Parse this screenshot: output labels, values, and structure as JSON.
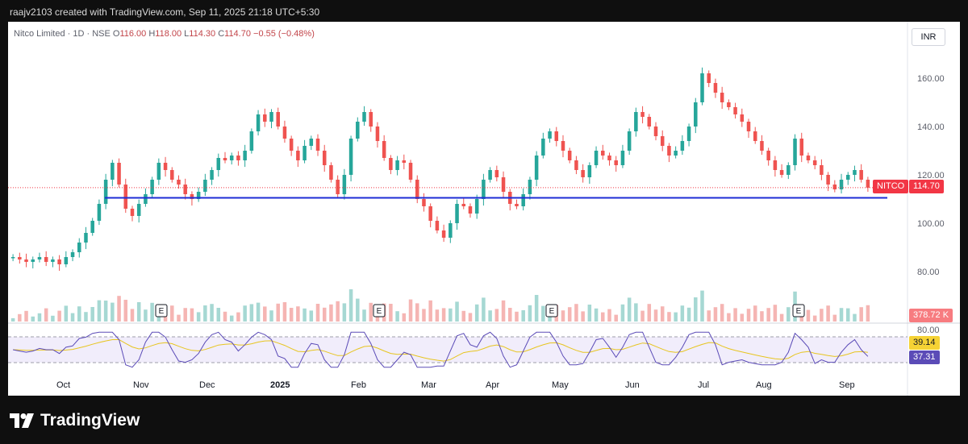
{
  "header": {
    "text": "raajv2103 created with TradingView.com, Sep 11, 2025 21:18 UTC+5:30"
  },
  "legend": {
    "symbol": "Nitco Limited · 1D · NSE",
    "o_label": "O",
    "o": "116.00",
    "h_label": "H",
    "h": "118.00",
    "l_label": "L",
    "l": "114.30",
    "c_label": "C",
    "c": "114.70",
    "change": "−0.55 (−0.48%)"
  },
  "currency": "INR",
  "tags": {
    "symbol": "NITCO",
    "price": "114.70",
    "volume": "378.72 K",
    "rsi_ma": "39.14",
    "rsi": "37.31"
  },
  "logo": {
    "text": "TradingView"
  },
  "colors": {
    "up": "#26a69a",
    "down": "#ef5350",
    "support": "#1e2dd6",
    "rsi": "#5b4bb7",
    "rsi_ma": "#e7c51f",
    "price_tag": "#f23645"
  },
  "chart_data": {
    "type": "candlestick",
    "x_labels": [
      "Oct",
      "Nov",
      "Dec",
      "2025",
      "Feb",
      "Mar",
      "Apr",
      "May",
      "Jun",
      "Jul",
      "Aug",
      "Sep"
    ],
    "y_ticks": [
      "160.00",
      "140.00",
      "120.00",
      "100.00",
      "80.00"
    ],
    "rsi_ticks": [
      "80.00"
    ],
    "earnings_markers": [
      "E",
      "E",
      "E",
      "E"
    ],
    "ylim": [
      70,
      170
    ],
    "support_level": 110.5,
    "last_price": 114.7,
    "closes": [
      86,
      85,
      84,
      85,
      86,
      84,
      85,
      83,
      86,
      88,
      92,
      96,
      101,
      108,
      118,
      125,
      116,
      106,
      103,
      108,
      112,
      118,
      125,
      122,
      118,
      116,
      112,
      110,
      113,
      118,
      122,
      127,
      126,
      128,
      126,
      130,
      138,
      145,
      142,
      146,
      140,
      135,
      130,
      126,
      132,
      135,
      130,
      124,
      118,
      112,
      120,
      135,
      142,
      146,
      140,
      134,
      127,
      122,
      126,
      125,
      118,
      110,
      107,
      101,
      97,
      94,
      100,
      108,
      107,
      104,
      110,
      118,
      122,
      119,
      113,
      108,
      107,
      112,
      118,
      128,
      135,
      138,
      134,
      130,
      126,
      122,
      119,
      124,
      130,
      128,
      126,
      124,
      130,
      138,
      146,
      144,
      140,
      136,
      132,
      128,
      130,
      134,
      140,
      150,
      162,
      158,
      154,
      150,
      148,
      145,
      142,
      138,
      134,
      130,
      126,
      122,
      120,
      124,
      135,
      128,
      126,
      124,
      120,
      116,
      114,
      118,
      120,
      122,
      118,
      114.7
    ],
    "rsi_range": [
      20,
      80
    ]
  }
}
